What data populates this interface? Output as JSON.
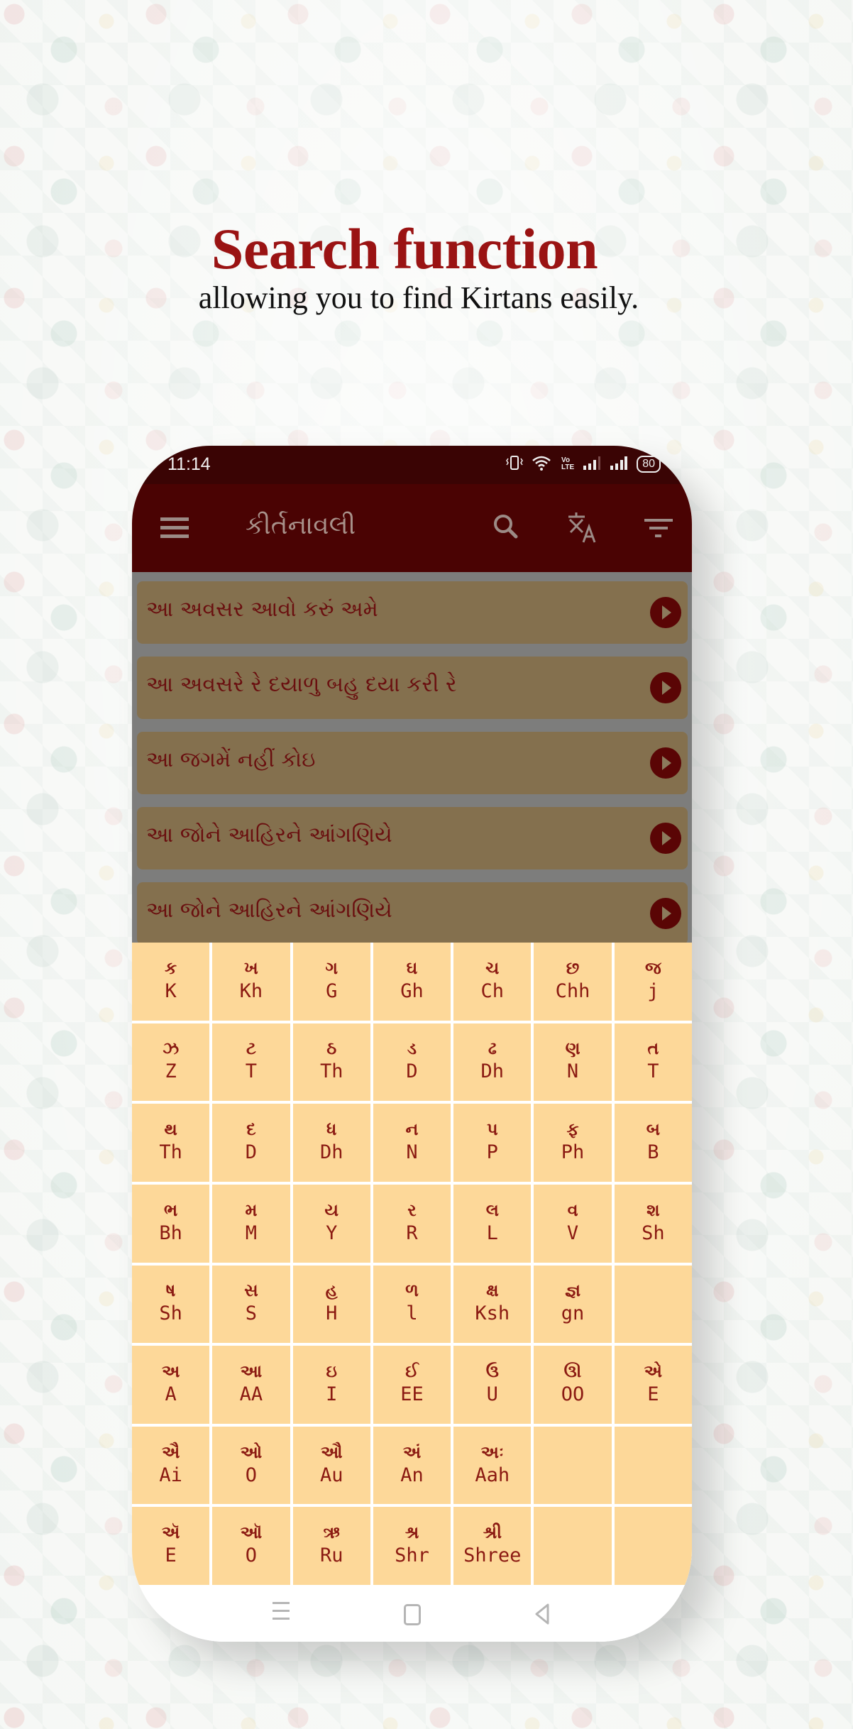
{
  "promo": {
    "title": "Search function",
    "subtitle": "allowing you to find Kirtans easily."
  },
  "status_bar": {
    "time": "11:14",
    "battery": "80",
    "icons": [
      "vibrate-icon",
      "wifi-icon",
      "volte-icon",
      "signal-icon",
      "signal-icon",
      "battery-icon"
    ],
    "volte_top": "Vo",
    "volte_bottom": "LTE"
  },
  "toolbar": {
    "title": "કીર્તનાવલી",
    "icons": [
      "menu-icon",
      "search-icon",
      "translate-icon",
      "filter-icon"
    ]
  },
  "colors": {
    "status_bar": "#3a0404",
    "toolbar": "#4a0303",
    "card": "#84704e",
    "card_text": "#6a0f0f",
    "key_bg": "#fdd899",
    "key_text": "#8b1a12",
    "headline": "#9a1313"
  },
  "kirtans": [
    {
      "title": "આ અવસર આવો કરું અમે"
    },
    {
      "title": "આ અવસરે રે દયાળુ બહુ દયા કરી રે"
    },
    {
      "title": "આ જગમેં નહીં કોઇ"
    },
    {
      "title": "આ જોને આહિરને આંગણિયે"
    },
    {
      "title": "આ જોને આહિરને આંગણિયે"
    }
  ],
  "keyboard": [
    {
      "guj": "ક",
      "lat": "K"
    },
    {
      "guj": "ખ",
      "lat": "Kh"
    },
    {
      "guj": "ગ",
      "lat": "G"
    },
    {
      "guj": "ઘ",
      "lat": "Gh"
    },
    {
      "guj": "ચ",
      "lat": "Ch"
    },
    {
      "guj": "છ",
      "lat": "Chh"
    },
    {
      "guj": "જ",
      "lat": "j"
    },
    {
      "guj": "ઝ",
      "lat": "Z"
    },
    {
      "guj": "ટ",
      "lat": "T"
    },
    {
      "guj": "ઠ",
      "lat": "Th"
    },
    {
      "guj": "ડ",
      "lat": "D"
    },
    {
      "guj": "ઢ",
      "lat": "Dh"
    },
    {
      "guj": "ણ",
      "lat": "N"
    },
    {
      "guj": "ત",
      "lat": "T"
    },
    {
      "guj": "થ",
      "lat": "Th"
    },
    {
      "guj": "દ",
      "lat": "D"
    },
    {
      "guj": "ધ",
      "lat": "Dh"
    },
    {
      "guj": "ન",
      "lat": "N"
    },
    {
      "guj": "પ",
      "lat": "P"
    },
    {
      "guj": "ફ",
      "lat": "Ph"
    },
    {
      "guj": "બ",
      "lat": "B"
    },
    {
      "guj": "ભ",
      "lat": "Bh"
    },
    {
      "guj": "મ",
      "lat": "M"
    },
    {
      "guj": "ય",
      "lat": "Y"
    },
    {
      "guj": "ર",
      "lat": "R"
    },
    {
      "guj": "લ",
      "lat": "L"
    },
    {
      "guj": "વ",
      "lat": "V"
    },
    {
      "guj": "શ",
      "lat": "Sh"
    },
    {
      "guj": "ષ",
      "lat": "Sh"
    },
    {
      "guj": "સ",
      "lat": "S"
    },
    {
      "guj": "હ",
      "lat": "H"
    },
    {
      "guj": "ળ",
      "lat": "l"
    },
    {
      "guj": "ક્ષ",
      "lat": "Ksh"
    },
    {
      "guj": "જ્ઞ",
      "lat": "gn"
    },
    {
      "guj": "",
      "lat": ""
    },
    {
      "guj": "અ",
      "lat": "A"
    },
    {
      "guj": "આ",
      "lat": "AA"
    },
    {
      "guj": "ઇ",
      "lat": "I"
    },
    {
      "guj": "ઈ",
      "lat": "EE"
    },
    {
      "guj": "ઉ",
      "lat": "U"
    },
    {
      "guj": "ઊ",
      "lat": "OO"
    },
    {
      "guj": "એ",
      "lat": "E"
    },
    {
      "guj": "ઐ",
      "lat": "Ai"
    },
    {
      "guj": "ઓ",
      "lat": "O"
    },
    {
      "guj": "ઔ",
      "lat": "Au"
    },
    {
      "guj": "અં",
      "lat": "An"
    },
    {
      "guj": "અઃ",
      "lat": "Aah"
    },
    {
      "guj": "",
      "lat": ""
    },
    {
      "guj": "",
      "lat": ""
    },
    {
      "guj": "ઍ",
      "lat": "E"
    },
    {
      "guj": "ઑ",
      "lat": "O"
    },
    {
      "guj": "ઋ",
      "lat": "Ru"
    },
    {
      "guj": "શ્ર",
      "lat": "Shr"
    },
    {
      "guj": "શ્રી",
      "lat": "Shree"
    },
    {
      "guj": "",
      "lat": ""
    },
    {
      "guj": "",
      "lat": ""
    }
  ],
  "nav_bar": {
    "icons": [
      "recent-apps-icon",
      "home-icon",
      "back-icon"
    ]
  }
}
